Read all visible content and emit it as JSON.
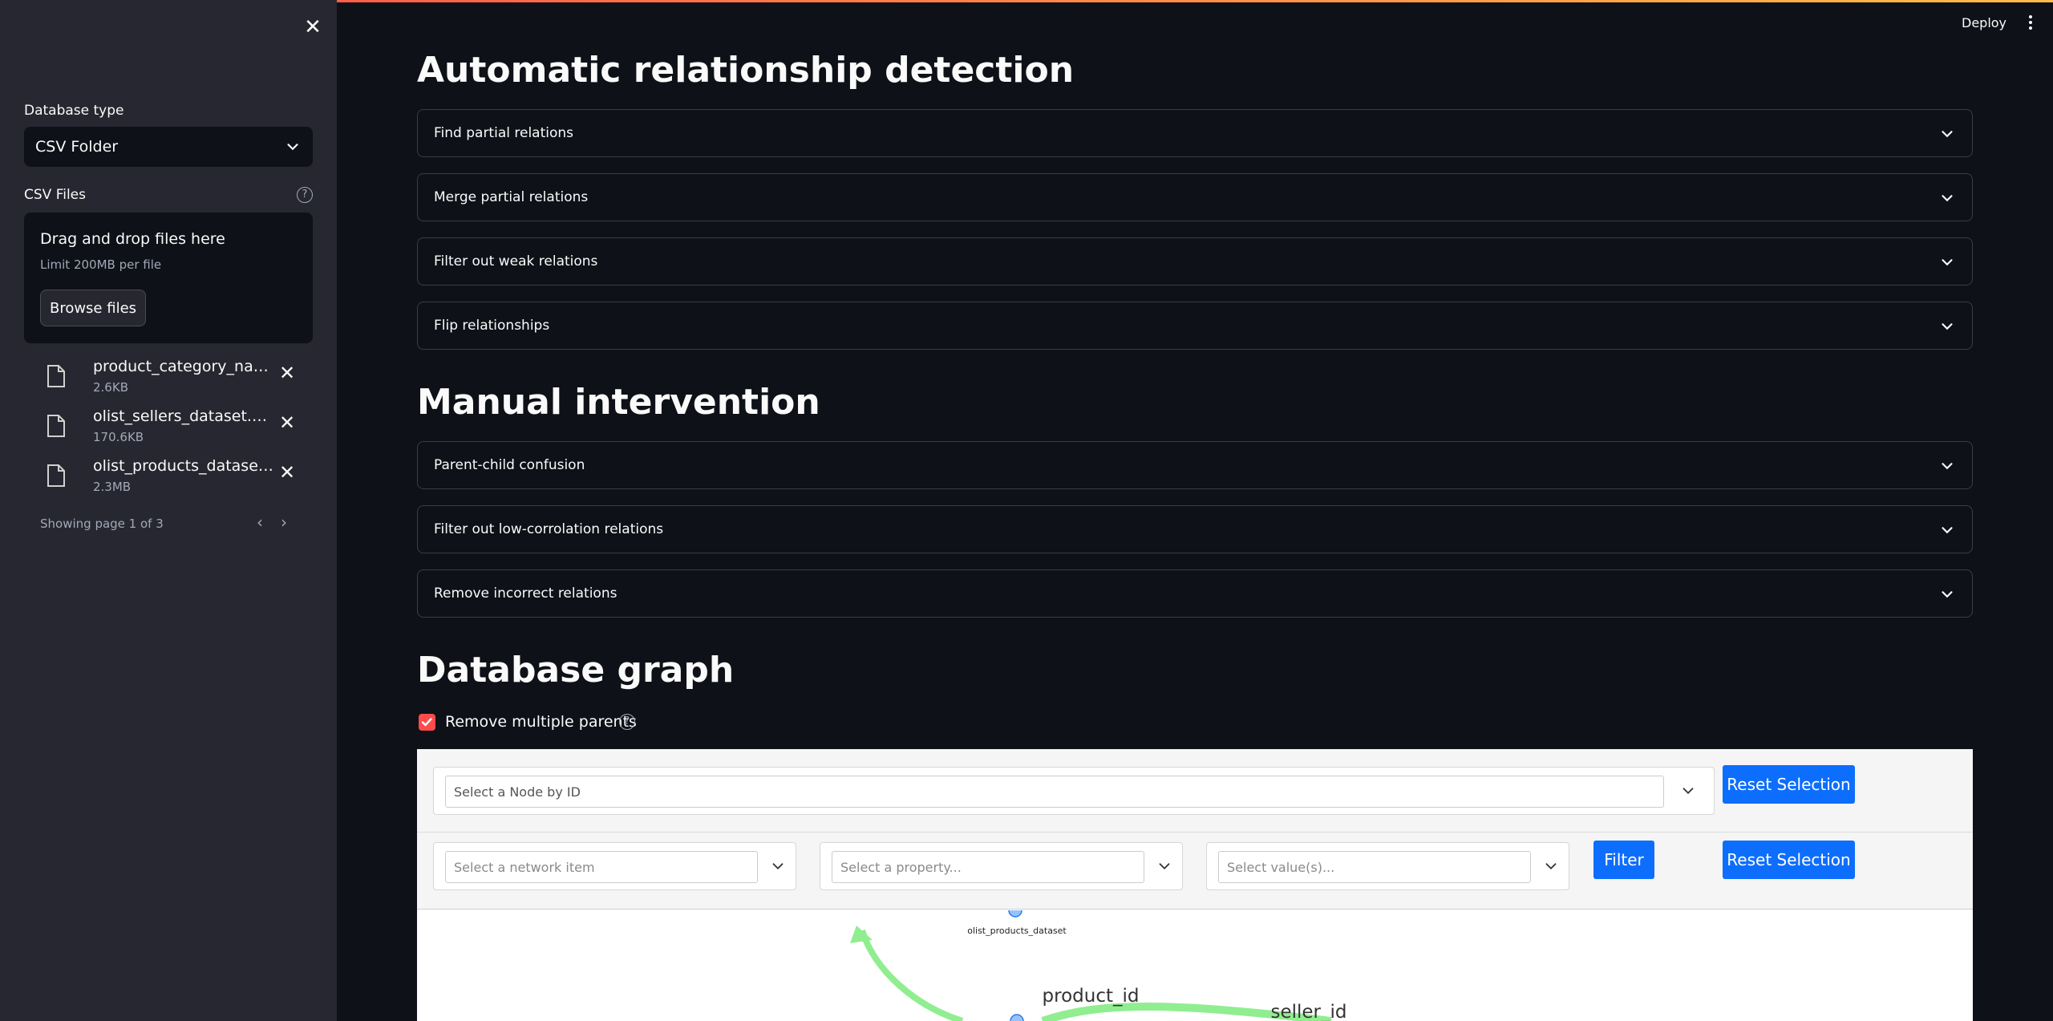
{
  "sidebar": {
    "database_type_label": "Database type",
    "database_type_value": "CSV Folder",
    "csv_files_label": "CSV Files",
    "dropzone_title": "Drag and drop files here",
    "dropzone_limit": "Limit 200MB per file",
    "browse_label": "Browse files",
    "files": [
      {
        "name": "product_category_name_translation.csv",
        "size": "2.6KB"
      },
      {
        "name": "olist_sellers_dataset.csv",
        "size": "170.6KB"
      },
      {
        "name": "olist_products_dataset.csv",
        "size": "2.3MB"
      }
    ],
    "pager_text": "Showing page 1 of 3"
  },
  "header": {
    "deploy_label": "Deploy"
  },
  "main": {
    "section1_title": "Automatic relationship detection",
    "section1_expanders": [
      "Find partial relations",
      "Merge partial relations",
      "Filter out weak relations",
      "Flip relationships"
    ],
    "section2_title": "Manual intervention",
    "section2_expanders": [
      "Parent-child confusion",
      "Filter out low-corrolation relations",
      "Remove incorrect relations"
    ],
    "section3_title": "Database graph",
    "checkbox_label": "Remove multiple parents",
    "checkbox_checked": true
  },
  "graph": {
    "node_select_placeholder": "Select a Node by ID",
    "reset_label": "Reset Selection",
    "network_item_placeholder": "Select a network item",
    "property_placeholder": "Select a property...",
    "value_placeholder": "Select value(s)...",
    "filter_label": "Filter",
    "node_label": "olist_products_dataset",
    "edge_labels": [
      "product_id",
      "seller_id"
    ],
    "edge_color": "#90ee90",
    "node_color": "#97c2fc"
  },
  "colors": {
    "accent": "#ff4b4b",
    "button_blue": "#0d6efd"
  }
}
